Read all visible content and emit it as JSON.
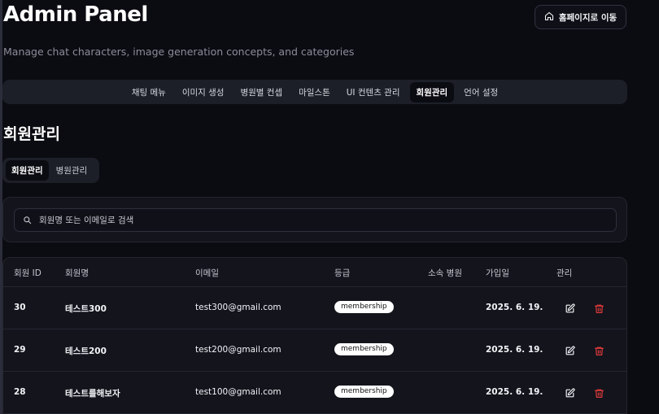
{
  "header": {
    "title": "Admin Panel",
    "subtitle": "Manage chat characters, image generation concepts, and categories",
    "home_button": "홈페이지로 이동"
  },
  "nav": {
    "tabs": [
      {
        "label": "채팅 메뉴"
      },
      {
        "label": "이미지 생성"
      },
      {
        "label": "병원별 컨셉"
      },
      {
        "label": "마일스톤"
      },
      {
        "label": "UI 컨텐츠 관리"
      },
      {
        "label": "회원관리",
        "active": true
      },
      {
        "label": "언어 설정"
      }
    ]
  },
  "section": {
    "title": "회원관리",
    "sub_tabs": [
      {
        "label": "회원관리",
        "active": true
      },
      {
        "label": "병원관리"
      }
    ]
  },
  "search": {
    "placeholder": "회원명 또는 이메일로 검색",
    "value": ""
  },
  "table": {
    "headers": [
      "회원 ID",
      "회원명",
      "이메일",
      "등급",
      "소속 병원",
      "가입일",
      "관리"
    ],
    "rows": [
      {
        "id": "30",
        "name": "테스트300",
        "email": "test300@gmail.com",
        "grade": "membership",
        "hospital": "",
        "joined": "2025. 6. 19."
      },
      {
        "id": "29",
        "name": "테스트200",
        "email": "test200@gmail.com",
        "grade": "membership",
        "hospital": "",
        "joined": "2025. 6. 19."
      },
      {
        "id": "28",
        "name": "테스트를해보자",
        "email": "test100@gmail.com",
        "grade": "membership",
        "hospital": "",
        "joined": "2025. 6. 19."
      }
    ]
  },
  "icons": {
    "home": "home-icon",
    "search": "search-icon",
    "edit": "edit-icon",
    "delete": "trash-icon"
  },
  "colors": {
    "background": "#0b0c12",
    "delete": "#e23b3b",
    "badge_bg": "#ffffff"
  }
}
